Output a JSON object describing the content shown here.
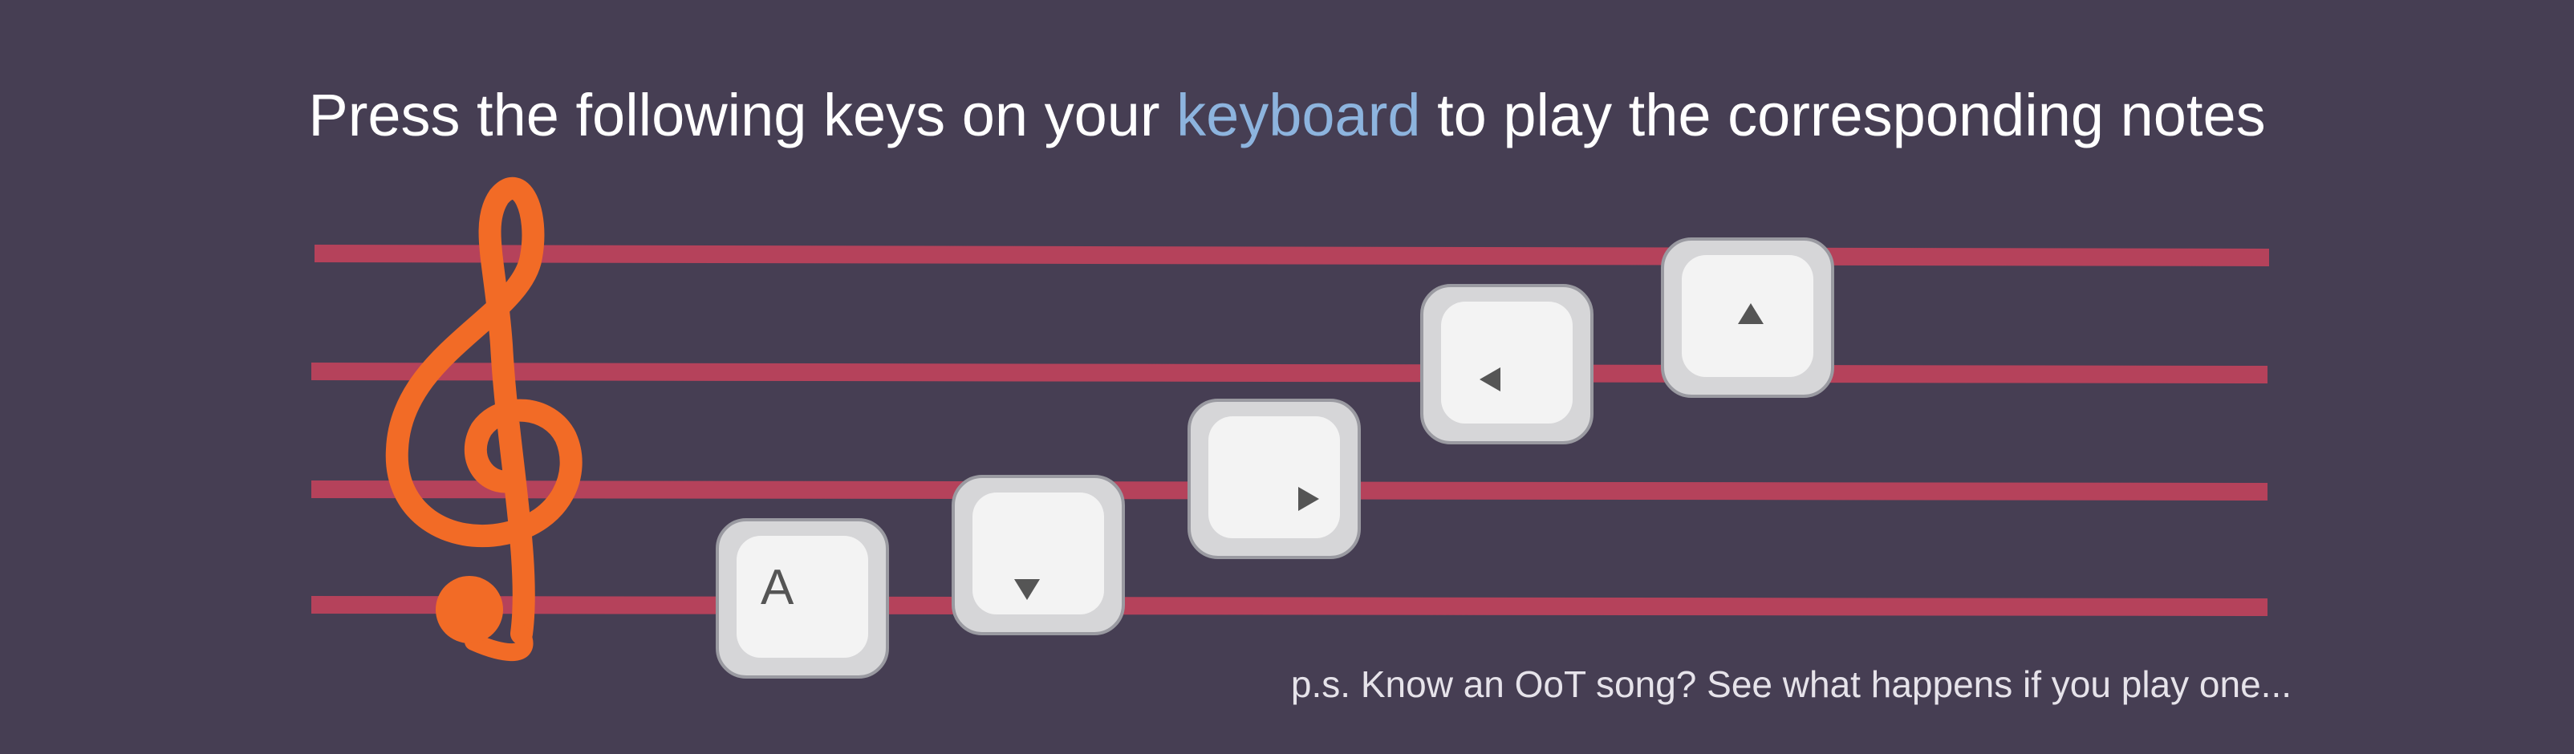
{
  "header": {
    "before_link": "Press the following keys on your ",
    "link_text": "keyboard",
    "after_link": " to play the corresponding notes"
  },
  "keys": [
    {
      "name": "a-key",
      "label": "A",
      "icon": "letter"
    },
    {
      "name": "down-arrow-key",
      "label": "",
      "icon": "triangle-down-icon"
    },
    {
      "name": "right-arrow-key",
      "label": "",
      "icon": "triangle-right-icon"
    },
    {
      "name": "left-arrow-key",
      "label": "",
      "icon": "triangle-left-icon"
    },
    {
      "name": "up-arrow-key",
      "label": "",
      "icon": "triangle-up-icon"
    }
  ],
  "footnote": "p.s. Know an OoT song? See what happens if you play one...",
  "colors": {
    "background": "#463e53",
    "staff_line": "#b5425b",
    "treble_clef": "#f26b26",
    "link": "#8db4de",
    "key_outer": "#d6d6d8",
    "key_cap": "#f3f3f3"
  },
  "icons": {
    "clef": "treble-clef-icon"
  }
}
